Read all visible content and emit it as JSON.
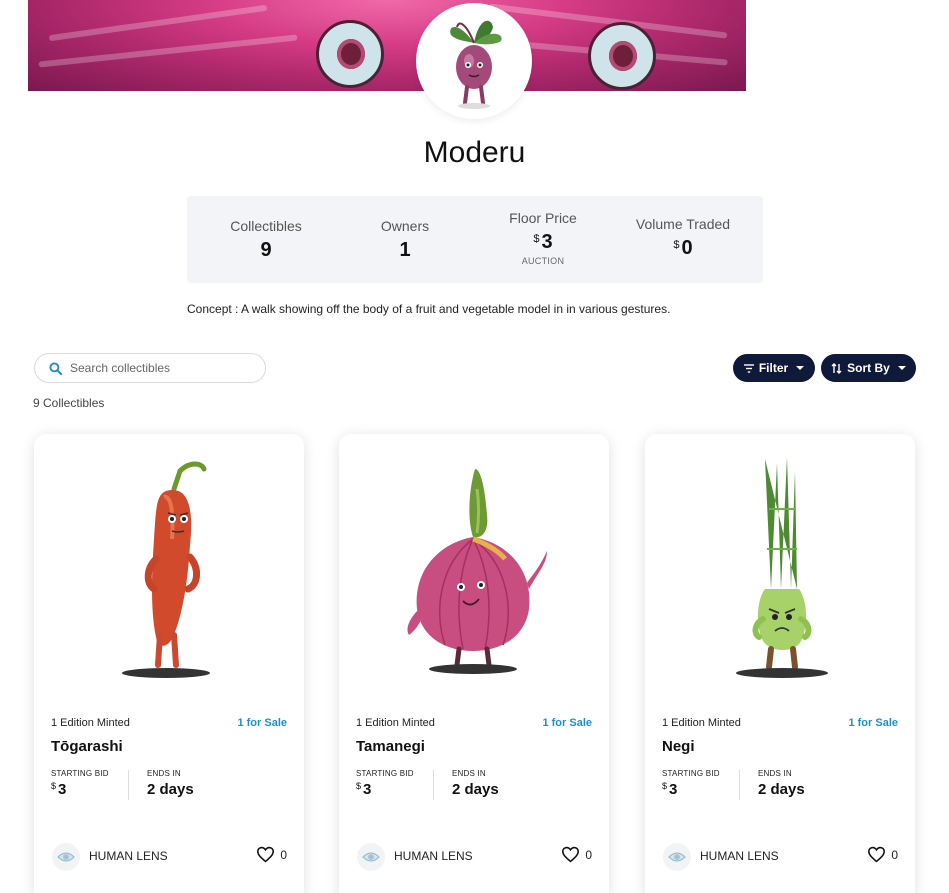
{
  "collection": {
    "name": "Moderu",
    "concept": "Concept : A walk showing off the body of a fruit and vegetable model in in various gestures."
  },
  "stats": {
    "collectibles": {
      "label": "Collectibles",
      "value": "9"
    },
    "owners": {
      "label": "Owners",
      "value": "1"
    },
    "floor_price": {
      "label": "Floor Price",
      "currency": "$",
      "value": "3",
      "sub": "AUCTION"
    },
    "volume_traded": {
      "label": "Volume Traded",
      "currency": "$",
      "value": "0"
    }
  },
  "toolbar": {
    "search_placeholder": "Search collectibles",
    "count_text": "9 Collectibles",
    "filter_label": "Filter",
    "sort_label": "Sort By"
  },
  "colors": {
    "accent_dark": "#0f1a3a",
    "for_sale": "#1e8fc6",
    "banner_pink": "#d63c86"
  },
  "cards": [
    {
      "editions": "1 Edition Minted",
      "for_sale": "1 for Sale",
      "name": "Tōgarashi",
      "bid_label": "STARTING BID",
      "currency": "$",
      "bid_value": "3",
      "ends_label": "ENDS IN",
      "ends_value": "2 days",
      "creator": "HUMAN LENS",
      "likes": "0",
      "art_icon": "chili-pepper-character"
    },
    {
      "editions": "1 Edition Minted",
      "for_sale": "1 for Sale",
      "name": "Tamanegi",
      "bid_label": "STARTING BID",
      "currency": "$",
      "bid_value": "3",
      "ends_label": "ENDS IN",
      "ends_value": "2 days",
      "creator": "HUMAN LENS",
      "likes": "0",
      "art_icon": "onion-character"
    },
    {
      "editions": "1 Edition Minted",
      "for_sale": "1 for Sale",
      "name": "Negi",
      "bid_label": "STARTING BID",
      "currency": "$",
      "bid_value": "3",
      "ends_label": "ENDS IN",
      "ends_value": "2 days",
      "creator": "HUMAN LENS",
      "likes": "0",
      "art_icon": "green-onion-character"
    }
  ]
}
